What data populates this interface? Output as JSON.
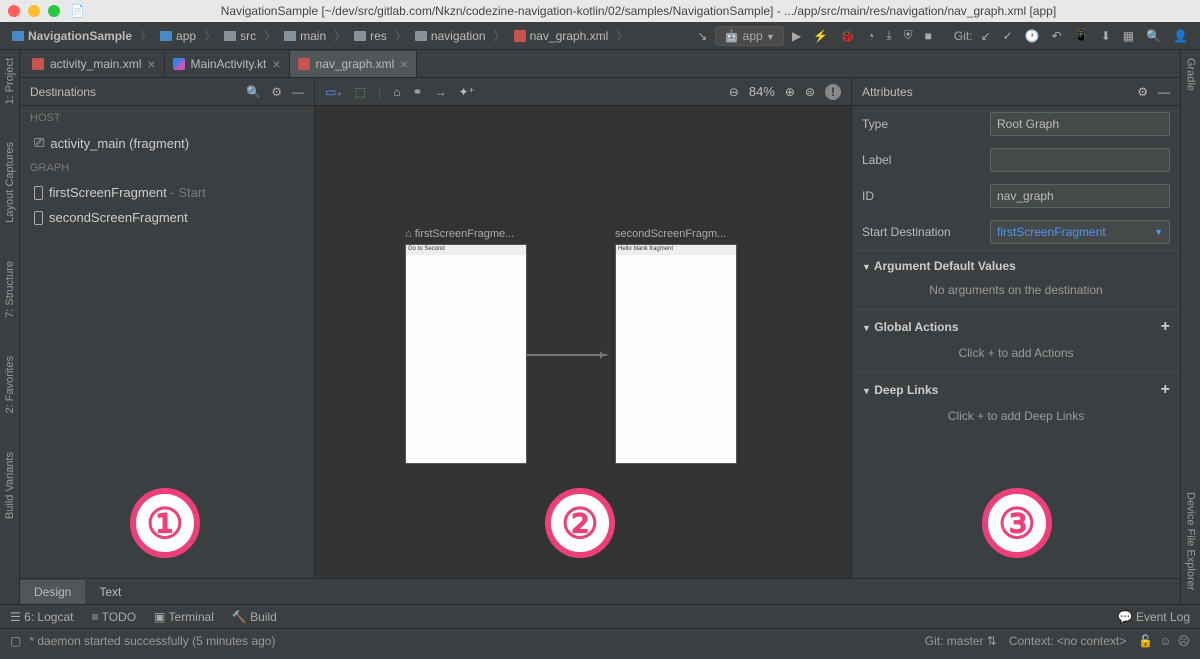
{
  "window": {
    "title": "NavigationSample [~/dev/src/gitlab.com/Nkzn/codezine-navigation-kotlin/02/samples/NavigationSample] - .../app/src/main/res/navigation/nav_graph.xml [app]"
  },
  "breadcrumb": {
    "project": "NavigationSample",
    "module": "app",
    "path": [
      "src",
      "main",
      "res",
      "navigation"
    ],
    "file": "nav_graph.xml"
  },
  "run_config": "app",
  "git_label": "Git:",
  "left_rail": [
    "1: Project",
    "Layout Captures",
    "7: Structure",
    "2: Favorites",
    "Build Variants"
  ],
  "right_rail_top": "Gradle",
  "right_rail_bottom": "Device File Explorer",
  "tabs": [
    {
      "name": "activity_main.xml",
      "type": "xml"
    },
    {
      "name": "MainActivity.kt",
      "type": "kt"
    },
    {
      "name": "nav_graph.xml",
      "type": "xml",
      "active": true
    }
  ],
  "destinations": {
    "title": "Destinations",
    "host_label": "HOST",
    "host_item": "activity_main (fragment)",
    "graph_label": "GRAPH",
    "items": [
      {
        "name": "firstScreenFragment",
        "suffix": " - Start"
      },
      {
        "name": "secondScreenFragment",
        "suffix": ""
      }
    ]
  },
  "canvas": {
    "zoom": "84%",
    "screens": [
      {
        "label": "firstScreenFragme...",
        "bar_text": "Go to Second",
        "home": true
      },
      {
        "label": "secondScreenFragm...",
        "bar_text": "Hello blank fragment",
        "home": false
      }
    ]
  },
  "attributes": {
    "title": "Attributes",
    "rows": {
      "type_label": "Type",
      "type_value": "Root Graph",
      "label_label": "Label",
      "label_value": "",
      "id_label": "ID",
      "id_value": "nav_graph",
      "start_label": "Start Destination",
      "start_value": "firstScreenFragment"
    },
    "sections": {
      "args_title": "Argument Default Values",
      "args_sub": "No arguments on the destination",
      "actions_title": "Global Actions",
      "actions_sub": "Click + to add Actions",
      "deeplinks_title": "Deep Links",
      "deeplinks_sub": "Click + to add Deep Links"
    }
  },
  "design_tabs": {
    "design": "Design",
    "text": "Text"
  },
  "bottom": {
    "logcat": "6: Logcat",
    "todo": "TODO",
    "terminal": "Terminal",
    "build": "Build",
    "event_log": "Event Log"
  },
  "status": {
    "message": "* daemon started successfully (5 minutes ago)",
    "git": "Git: master",
    "context": "Context: <no context>"
  },
  "annotations": {
    "one": "①",
    "two": "②",
    "three": "③"
  }
}
